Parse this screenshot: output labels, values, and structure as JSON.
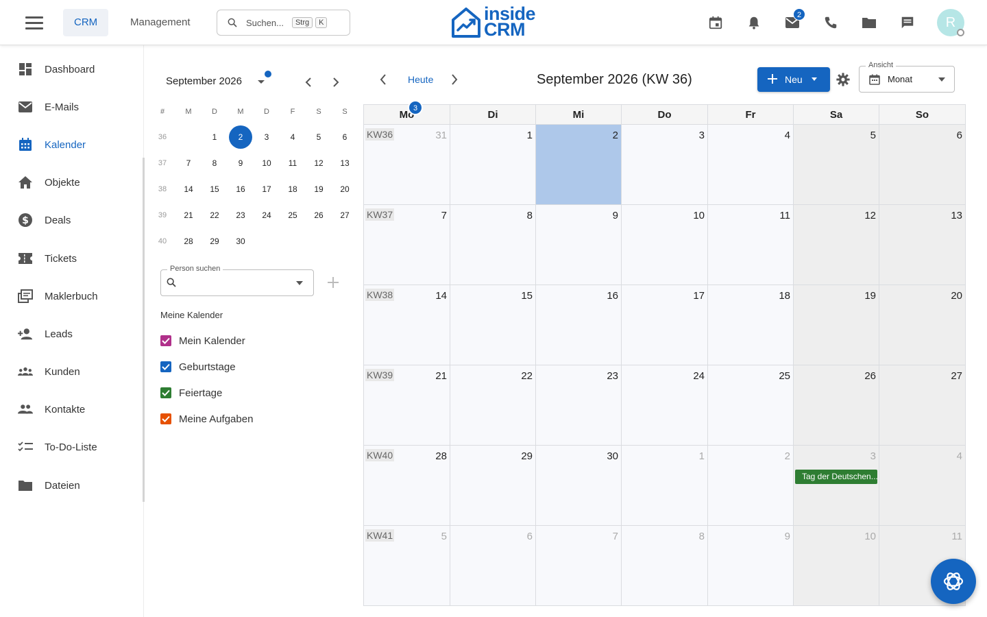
{
  "colors": {
    "accent": "#1565c0",
    "today": "#aec8ea",
    "event": "#2e7d32"
  },
  "header": {
    "tabs": [
      {
        "label": "CRM",
        "active": true
      },
      {
        "label": "Management",
        "active": false
      }
    ],
    "search": {
      "label": "Suchen...",
      "key1": "Strg",
      "key2": "K"
    },
    "logo": {
      "line1": "inside",
      "line2": "CRM"
    },
    "icons": [
      "calendar-icon",
      "bell-icon",
      "mail-icon",
      "phone-icon",
      "folder-icon",
      "chat-icon"
    ],
    "mail_badge": "2",
    "avatar_initial": "R"
  },
  "sidebar": {
    "items": [
      {
        "label": "Dashboard",
        "icon": "dashboard-icon"
      },
      {
        "label": "E-Mails",
        "icon": "mail-icon"
      },
      {
        "label": "Kalender",
        "icon": "calendar-icon",
        "active": true
      },
      {
        "label": "Objekte",
        "icon": "home-icon"
      },
      {
        "label": "Deals",
        "icon": "dollar-icon"
      },
      {
        "label": "Tickets",
        "icon": "ticket-icon"
      },
      {
        "label": "Maklerbuch",
        "icon": "library-icon"
      },
      {
        "label": "Leads",
        "icon": "person-add-icon"
      },
      {
        "label": "Kunden",
        "icon": "groups-icon"
      },
      {
        "label": "Kontakte",
        "icon": "people-icon"
      },
      {
        "label": "To-Do-Liste",
        "icon": "checklist-icon"
      },
      {
        "label": "Dateien",
        "icon": "folder-icon"
      }
    ]
  },
  "mini_calendar": {
    "title": "September 2026",
    "headers": [
      "#",
      "M",
      "D",
      "M",
      "D",
      "F",
      "S",
      "S"
    ],
    "weeks": [
      {
        "kw": "36",
        "days": [
          "",
          "1",
          "2",
          "3",
          "4",
          "5",
          "6"
        ]
      },
      {
        "kw": "37",
        "days": [
          "7",
          "8",
          "9",
          "10",
          "11",
          "12",
          "13"
        ]
      },
      {
        "kw": "38",
        "days": [
          "14",
          "15",
          "16",
          "17",
          "18",
          "19",
          "20"
        ]
      },
      {
        "kw": "39",
        "days": [
          "21",
          "22",
          "23",
          "24",
          "25",
          "26",
          "27"
        ]
      },
      {
        "kw": "40",
        "days": [
          "28",
          "29",
          "30",
          "",
          "",
          "",
          ""
        ]
      }
    ],
    "selected": "2"
  },
  "person_search": {
    "label": "Person suchen"
  },
  "my_calendars": {
    "title": "Meine Kalender",
    "items": [
      {
        "label": "Mein Kalender",
        "color": "#b0308a"
      },
      {
        "label": "Geburtstage",
        "color": "#1565c0"
      },
      {
        "label": "Feiertage",
        "color": "#2e7d32"
      },
      {
        "label": "Meine Aufgaben",
        "color": "#e65100"
      }
    ]
  },
  "main": {
    "today_label": "Heute",
    "title": "September 2026 (KW 36)",
    "new_label": "Neu",
    "view": {
      "label": "Ansicht",
      "value": "Monat"
    },
    "weekdays": [
      "Mo",
      "Di",
      "Mi",
      "Do",
      "Fr",
      "Sa",
      "So"
    ],
    "header_badge": "3",
    "weeks": [
      {
        "kw": "KW36",
        "days": [
          {
            "d": "31",
            "other": true
          },
          {
            "d": "1"
          },
          {
            "d": "2",
            "today": true
          },
          {
            "d": "3"
          },
          {
            "d": "4"
          },
          {
            "d": "5"
          },
          {
            "d": "6"
          }
        ]
      },
      {
        "kw": "KW37",
        "days": [
          {
            "d": "7"
          },
          {
            "d": "8"
          },
          {
            "d": "9"
          },
          {
            "d": "10"
          },
          {
            "d": "11"
          },
          {
            "d": "12"
          },
          {
            "d": "13"
          }
        ]
      },
      {
        "kw": "KW38",
        "days": [
          {
            "d": "14"
          },
          {
            "d": "15"
          },
          {
            "d": "16"
          },
          {
            "d": "17"
          },
          {
            "d": "18"
          },
          {
            "d": "19"
          },
          {
            "d": "20"
          }
        ]
      },
      {
        "kw": "KW39",
        "days": [
          {
            "d": "21"
          },
          {
            "d": "22"
          },
          {
            "d": "23"
          },
          {
            "d": "24"
          },
          {
            "d": "25"
          },
          {
            "d": "26"
          },
          {
            "d": "27"
          }
        ]
      },
      {
        "kw": "KW40",
        "days": [
          {
            "d": "28"
          },
          {
            "d": "29"
          },
          {
            "d": "30"
          },
          {
            "d": "1",
            "other": true
          },
          {
            "d": "2",
            "other": true
          },
          {
            "d": "3",
            "other": true
          },
          {
            "d": "4",
            "other": true
          }
        ]
      },
      {
        "kw": "KW41",
        "days": [
          {
            "d": "5",
            "other": true
          },
          {
            "d": "6",
            "other": true
          },
          {
            "d": "7",
            "other": true
          },
          {
            "d": "8",
            "other": true
          },
          {
            "d": "9",
            "other": true
          },
          {
            "d": "10",
            "other": true
          },
          {
            "d": "11",
            "other": true
          }
        ]
      }
    ],
    "event": {
      "label": "Tag der Deutschen...",
      "calendar": "Feiertage"
    }
  }
}
